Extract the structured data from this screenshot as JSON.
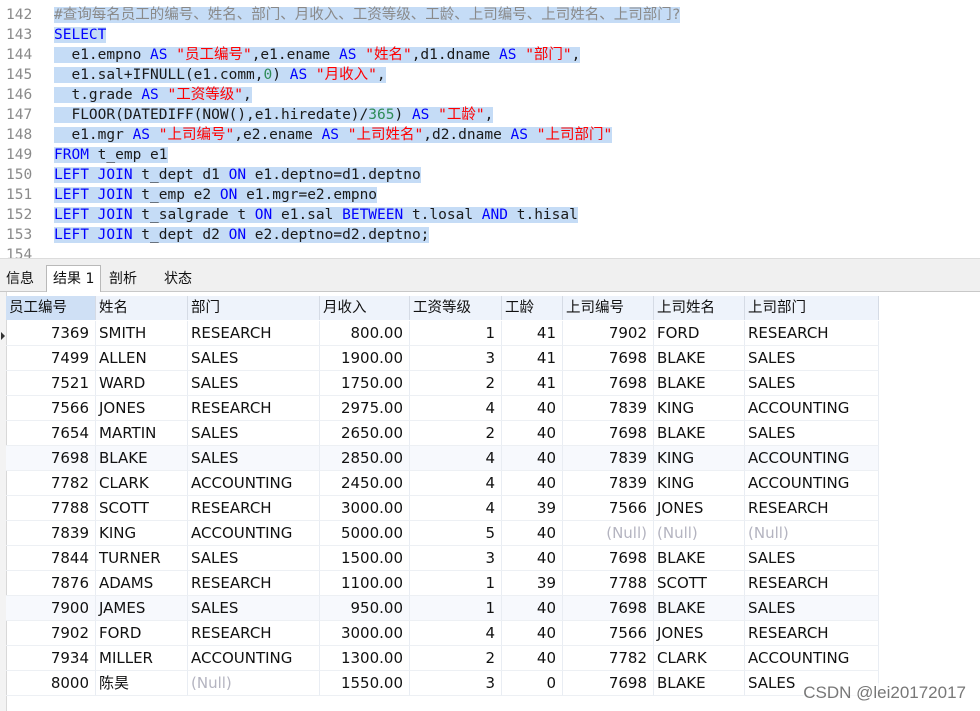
{
  "editor": {
    "lines": [
      {
        "num": "142",
        "tokens": [
          [
            "c",
            "#查询每名员工的编号、姓名、部门、月收入、工资等级、工龄、上司编号、上司姓名、上司部门?"
          ]
        ]
      },
      {
        "num": "143",
        "tokens": [
          [
            "k",
            "SELECT"
          ]
        ]
      },
      {
        "num": "144",
        "tokens": [
          [
            "t",
            "  e1.empno "
          ],
          [
            "k",
            "AS"
          ],
          [
            "t",
            " "
          ],
          [
            "s",
            "\"员工编号\""
          ],
          [
            "t",
            ",e1.ename "
          ],
          [
            "k",
            "AS"
          ],
          [
            "t",
            " "
          ],
          [
            "s",
            "\"姓名\""
          ],
          [
            "t",
            ",d1.dname "
          ],
          [
            "k",
            "AS"
          ],
          [
            "t",
            " "
          ],
          [
            "s",
            "\"部门\""
          ],
          [
            "t",
            ","
          ]
        ]
      },
      {
        "num": "145",
        "tokens": [
          [
            "t",
            "  e1.sal+IFNULL(e1.comm,"
          ],
          [
            "n",
            "0"
          ],
          [
            "t",
            ") "
          ],
          [
            "k",
            "AS"
          ],
          [
            "t",
            " "
          ],
          [
            "s",
            "\"月收入\""
          ],
          [
            "t",
            ","
          ]
        ]
      },
      {
        "num": "146",
        "tokens": [
          [
            "t",
            "  t.grade "
          ],
          [
            "k",
            "AS"
          ],
          [
            "t",
            " "
          ],
          [
            "s",
            "\"工资等级\""
          ],
          [
            "t",
            ","
          ]
        ]
      },
      {
        "num": "147",
        "tokens": [
          [
            "t",
            "  FLOOR(DATEDIFF(NOW(),e1.hiredate)/"
          ],
          [
            "n",
            "365"
          ],
          [
            "t",
            ") "
          ],
          [
            "k",
            "AS"
          ],
          [
            "t",
            " "
          ],
          [
            "s",
            "\"工龄\""
          ],
          [
            "t",
            ","
          ]
        ]
      },
      {
        "num": "148",
        "tokens": [
          [
            "t",
            "  e1.mgr "
          ],
          [
            "k",
            "AS"
          ],
          [
            "t",
            " "
          ],
          [
            "s",
            "\"上司编号\""
          ],
          [
            "t",
            ",e2.ename "
          ],
          [
            "k",
            "AS"
          ],
          [
            "t",
            " "
          ],
          [
            "s",
            "\"上司姓名\""
          ],
          [
            "t",
            ",d2.dname "
          ],
          [
            "k",
            "AS"
          ],
          [
            "t",
            " "
          ],
          [
            "s",
            "\"上司部门\""
          ]
        ]
      },
      {
        "num": "149",
        "tokens": [
          [
            "k",
            "FROM"
          ],
          [
            "t",
            " t_emp e1"
          ]
        ]
      },
      {
        "num": "150",
        "tokens": [
          [
            "k",
            "LEFT"
          ],
          [
            "t",
            " "
          ],
          [
            "k",
            "JOIN"
          ],
          [
            "t",
            " t_dept d1 "
          ],
          [
            "k",
            "ON"
          ],
          [
            "t",
            " e1.deptno=d1.deptno"
          ]
        ]
      },
      {
        "num": "151",
        "tokens": [
          [
            "k",
            "LEFT"
          ],
          [
            "t",
            " "
          ],
          [
            "k",
            "JOIN"
          ],
          [
            "t",
            " t_emp e2 "
          ],
          [
            "k",
            "ON"
          ],
          [
            "t",
            " e1.mgr=e2.empno"
          ]
        ]
      },
      {
        "num": "152",
        "tokens": [
          [
            "k",
            "LEFT"
          ],
          [
            "t",
            " "
          ],
          [
            "k",
            "JOIN"
          ],
          [
            "t",
            " t_salgrade t "
          ],
          [
            "k",
            "ON"
          ],
          [
            "t",
            " e1.sal "
          ],
          [
            "k",
            "BETWEEN"
          ],
          [
            "t",
            " t.losal "
          ],
          [
            "k",
            "AND"
          ],
          [
            "t",
            " t.hisal"
          ]
        ]
      },
      {
        "num": "153",
        "tokens": [
          [
            "k",
            "LEFT"
          ],
          [
            "t",
            " "
          ],
          [
            "k",
            "JOIN"
          ],
          [
            "t",
            " t_dept d2 "
          ],
          [
            "k",
            "ON"
          ],
          [
            "t",
            " e2.deptno=d2.deptno;"
          ]
        ]
      },
      {
        "num": "154",
        "tokens": []
      }
    ]
  },
  "tabs": [
    {
      "label": "信息",
      "active": false
    },
    {
      "label": "结果 1",
      "active": true
    },
    {
      "label": "剖析",
      "active": false
    },
    {
      "label": "状态",
      "active": false
    }
  ],
  "grid": {
    "columns": [
      "员工编号",
      "姓名",
      "部门",
      "月收入",
      "工资等级",
      "工龄",
      "上司编号",
      "上司姓名",
      "上司部门"
    ],
    "rows": [
      [
        "7369",
        "SMITH",
        "RESEARCH",
        "800.00",
        "1",
        "41",
        "7902",
        "FORD",
        "RESEARCH"
      ],
      [
        "7499",
        "ALLEN",
        "SALES",
        "1900.00",
        "3",
        "41",
        "7698",
        "BLAKE",
        "SALES"
      ],
      [
        "7521",
        "WARD",
        "SALES",
        "1750.00",
        "2",
        "41",
        "7698",
        "BLAKE",
        "SALES"
      ],
      [
        "7566",
        "JONES",
        "RESEARCH",
        "2975.00",
        "4",
        "40",
        "7839",
        "KING",
        "ACCOUNTING"
      ],
      [
        "7654",
        "MARTIN",
        "SALES",
        "2650.00",
        "2",
        "40",
        "7698",
        "BLAKE",
        "SALES"
      ],
      [
        "7698",
        "BLAKE",
        "SALES",
        "2850.00",
        "4",
        "40",
        "7839",
        "KING",
        "ACCOUNTING"
      ],
      [
        "7782",
        "CLARK",
        "ACCOUNTING",
        "2450.00",
        "4",
        "40",
        "7839",
        "KING",
        "ACCOUNTING"
      ],
      [
        "7788",
        "SCOTT",
        "RESEARCH",
        "3000.00",
        "4",
        "39",
        "7566",
        "JONES",
        "RESEARCH"
      ],
      [
        "7839",
        "KING",
        "ACCOUNTING",
        "5000.00",
        "5",
        "40",
        "(Null)",
        "(Null)",
        "(Null)"
      ],
      [
        "7844",
        "TURNER",
        "SALES",
        "1500.00",
        "3",
        "40",
        "7698",
        "BLAKE",
        "SALES"
      ],
      [
        "7876",
        "ADAMS",
        "RESEARCH",
        "1100.00",
        "1",
        "39",
        "7788",
        "SCOTT",
        "RESEARCH"
      ],
      [
        "7900",
        "JAMES",
        "SALES",
        "950.00",
        "1",
        "40",
        "7698",
        "BLAKE",
        "SALES"
      ],
      [
        "7902",
        "FORD",
        "RESEARCH",
        "3000.00",
        "4",
        "40",
        "7566",
        "JONES",
        "RESEARCH"
      ],
      [
        "7934",
        "MILLER",
        "ACCOUNTING",
        "1300.00",
        "2",
        "40",
        "7782",
        "CLARK",
        "ACCOUNTING"
      ],
      [
        "8000",
        "陈昊",
        "(Null)",
        "1550.00",
        "3",
        "0",
        "7698",
        "BLAKE",
        "SALES"
      ]
    ]
  },
  "watermark": "CSDN @lei20172017",
  "colors": {
    "selection": "#c5dcf6",
    "keyword": "#0000ff",
    "string": "#ff0000",
    "comment": "#8a8a8a",
    "number": "#2e8b57",
    "null": "#b4b4c0"
  }
}
